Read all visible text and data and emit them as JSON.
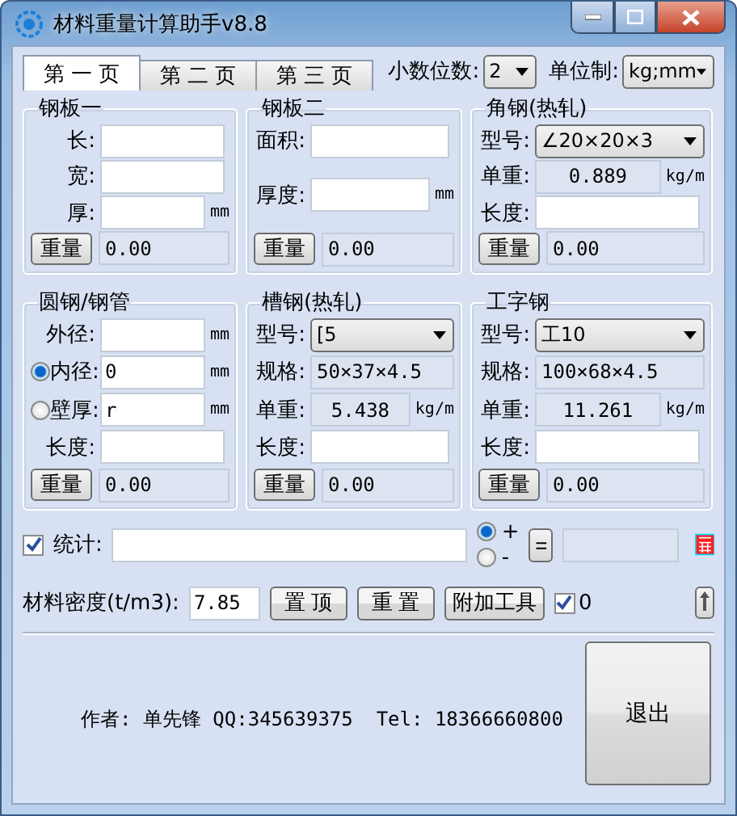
{
  "window": {
    "title": "材料重量计算助手v8.8"
  },
  "tabs": [
    {
      "label": "第 一 页",
      "selected": true
    },
    {
      "label": "第 二 页",
      "selected": false
    },
    {
      "label": "第 三 页",
      "selected": false
    }
  ],
  "decimals": {
    "label": "小数位数:",
    "value": "2"
  },
  "unit_system": {
    "label": "单位制:",
    "value": "kg;mm"
  },
  "groups": [
    {
      "title": "钢板一",
      "rows": [
        {
          "kind": "input",
          "label": "长:"
        },
        {
          "kind": "input",
          "label": "宽:"
        },
        {
          "kind": "input",
          "label": "厚:",
          "unit": "mm"
        }
      ],
      "weight_button": "重量",
      "weight_value": "0.00"
    },
    {
      "title": "钢板二",
      "rows": [
        {
          "kind": "input",
          "label": "面积:"
        },
        {
          "kind": "input",
          "label": "厚度:",
          "unit": "mm"
        }
      ],
      "weight_button": "重量",
      "weight_value": "0.00"
    },
    {
      "title": "角钢(热轧)",
      "rows": [
        {
          "kind": "select",
          "label": "型号:",
          "value": "∠20×20×3"
        },
        {
          "kind": "readout",
          "label": "单重:",
          "value": "0.889",
          "unit": "kg/m"
        },
        {
          "kind": "input",
          "label": "长度:"
        }
      ],
      "weight_button": "重量",
      "weight_value": "0.00"
    },
    {
      "title": "圆钢/钢管",
      "rows": [
        {
          "kind": "input",
          "label": "外径:",
          "unit": "mm"
        },
        {
          "kind": "radio",
          "label": "内径:",
          "value": "0",
          "unit": "mm",
          "selected": true
        },
        {
          "kind": "radio",
          "label": "壁厚:",
          "value": "r",
          "unit": "mm",
          "selected": false
        },
        {
          "kind": "input",
          "label": "长度:"
        }
      ],
      "weight_button": "重量",
      "weight_value": "0.00"
    },
    {
      "title": "槽钢(热轧)",
      "rows": [
        {
          "kind": "select",
          "label": "型号:",
          "value": "[5"
        },
        {
          "kind": "spec",
          "label": "规格:",
          "value": "50×37×4.5"
        },
        {
          "kind": "readout",
          "label": "单重:",
          "value": "5.438",
          "unit": "kg/m"
        },
        {
          "kind": "input",
          "label": "长度:"
        }
      ],
      "weight_button": "重量",
      "weight_value": "0.00"
    },
    {
      "title": "工字钢",
      "rows": [
        {
          "kind": "select",
          "label": "型号:",
          "value": "工10"
        },
        {
          "kind": "spec",
          "label": "规格:",
          "value": "100×68×4.5"
        },
        {
          "kind": "readout",
          "label": "单重:",
          "value": "11.261",
          "unit": "kg/m"
        },
        {
          "kind": "input",
          "label": "长度:"
        }
      ],
      "weight_button": "重量",
      "weight_value": "0.00"
    }
  ],
  "stats": {
    "label": "统计:",
    "checked": true,
    "operators": [
      {
        "label": "+",
        "selected": true
      },
      {
        "label": "-",
        "selected": false
      }
    ],
    "equals_button": "="
  },
  "density": {
    "label": "材料密度(t/m3):",
    "value": "7.85",
    "buttons": [
      "置 顶",
      "重 置",
      "附加工具"
    ],
    "checkbox_label": "0",
    "checked": true
  },
  "footer": {
    "author": "作者: 单先锋 QQ:345639375  Tel: 18366660800",
    "exit_button": "退出"
  }
}
